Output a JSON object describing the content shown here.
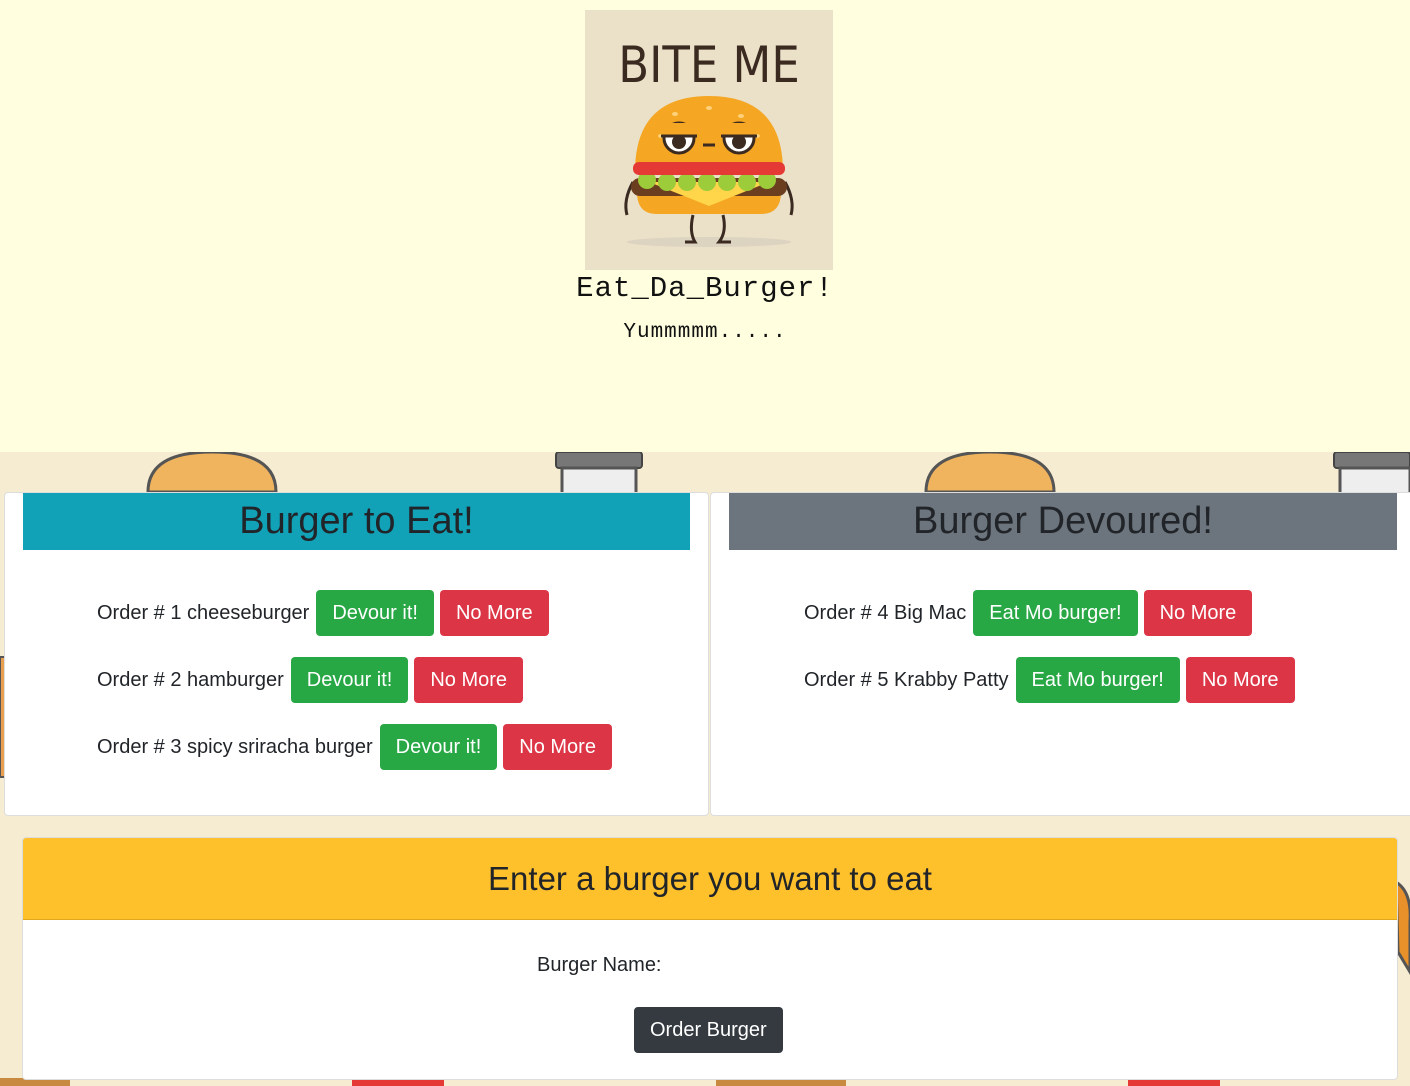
{
  "header": {
    "logo_text": "BITE ME",
    "title": "Eat_Da_Burger!",
    "subtitle": "Yummmmm....."
  },
  "to_eat": {
    "heading": "Burger to Eat!",
    "orders": [
      {
        "label": "Order # 1 cheeseburger",
        "primary": "Devour it!",
        "secondary": "No More"
      },
      {
        "label": "Order # 2 hamburger",
        "primary": "Devour it!",
        "secondary": "No More"
      },
      {
        "label": "Order # 3 spicy sriracha burger",
        "primary": "Devour it!",
        "secondary": "No More"
      }
    ]
  },
  "devoured": {
    "heading": "Burger Devoured!",
    "orders": [
      {
        "label": "Order # 4 Big Mac",
        "primary": "Eat Mo burger!",
        "secondary": "No More"
      },
      {
        "label": "Order # 5 Krabby Patty",
        "primary": "Eat Mo burger!",
        "secondary": "No More"
      }
    ]
  },
  "form": {
    "heading": "Enter a burger you want to eat",
    "label": "Burger Name:",
    "input_value": "",
    "submit": "Order Burger"
  },
  "colors": {
    "top_band": "#ffffe0",
    "to_eat_header": "#11a2b8",
    "devoured_header": "#6c757d",
    "form_header": "#ffc12b",
    "success": "#28a745",
    "danger": "#dc3545",
    "dark": "#343a40"
  },
  "icons": [
    "burger-mascot-icon",
    "burger-bun-icon",
    "soda-cup-icon",
    "fries-icon"
  ]
}
